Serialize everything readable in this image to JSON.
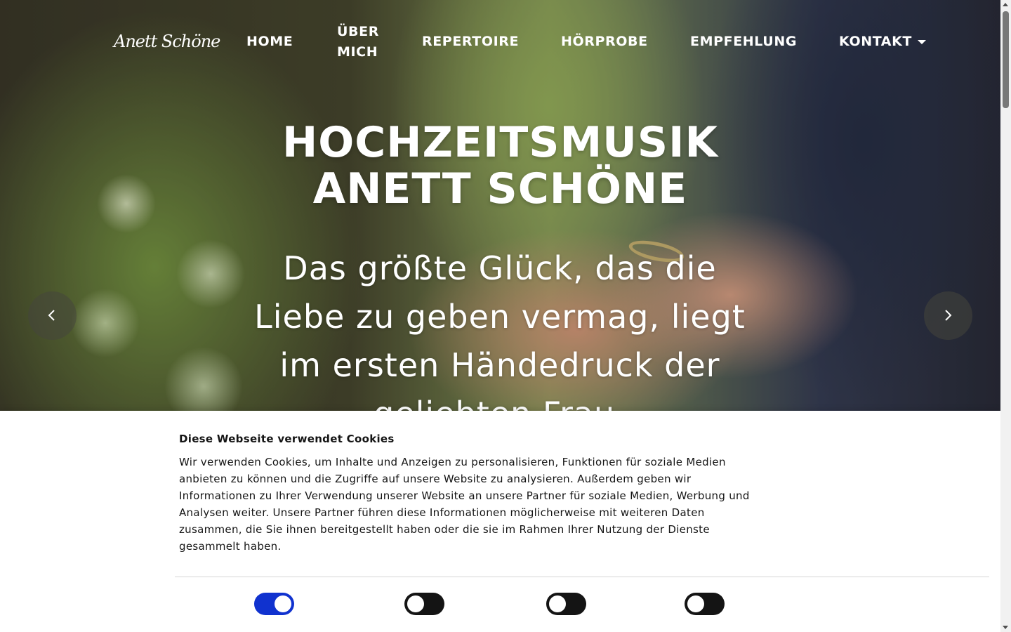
{
  "brand": {
    "logo_text": "Anett Schöne"
  },
  "nav": {
    "items": [
      {
        "label": "HOME"
      },
      {
        "label": "ÜBER MICH"
      },
      {
        "label": "REPERTOIRE"
      },
      {
        "label": "HÖRPROBE"
      },
      {
        "label": "EMPFEHLUNG"
      },
      {
        "label": "KONTAKT",
        "has_dropdown": true
      }
    ]
  },
  "hero": {
    "title_line1": "HOCHZEITSMUSIK",
    "title_line2": "ANETT SCHÖNE",
    "quote": "Das größte Glück, das die Liebe zu geben vermag, liegt im ersten Händedruck der geliebten Frau."
  },
  "carousel": {
    "prev_icon": "chevron-left-icon",
    "next_icon": "chevron-right-icon"
  },
  "cookie_banner": {
    "title": "Diese Webseite verwendet Cookies",
    "text": "Wir verwenden Cookies, um Inhalte und Anzeigen zu personalisieren, Funktionen für soziale Medien anbieten zu können und die Zugriffe auf unsere Website zu analysieren. Außerdem geben wir Informationen zu Ihrer Verwendung unserer Website an unsere Partner für soziale Medien, Werbung und Analysen weiter. Unsere Partner führen diese Informationen möglicherweise mit weiteren Daten zusammen, die Sie ihnen bereitgestellt haben oder die sie im Rahmen Ihrer Nutzung der Dienste gesammelt haben.",
    "toggles": [
      {
        "state": "on"
      },
      {
        "state": "off"
      },
      {
        "state": "off"
      },
      {
        "state": "off"
      }
    ]
  },
  "colors": {
    "toggle_on": "#1032cf",
    "toggle_off": "#141414",
    "text": "#141414"
  }
}
